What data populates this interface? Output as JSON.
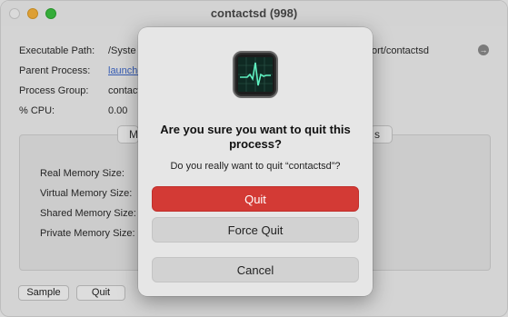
{
  "window": {
    "title": "contactsd (998)"
  },
  "info": {
    "executable_label": "Executable Path:",
    "executable_value": "/Syste",
    "executable_tail": "ort/contactsd",
    "parent_label": "Parent Process:",
    "parent_value": "launchd",
    "group_label": "Process Group:",
    "group_value": "contacts",
    "cpu_label": "% CPU:",
    "cpu_value": "0.00"
  },
  "tabs": {
    "left_fragment": "M",
    "right_fragment": "s"
  },
  "memory": {
    "real": "Real Memory Size:",
    "virtual": "Virtual Memory Size:",
    "shared": "Shared Memory Size:",
    "private": "Private Memory Size:"
  },
  "bottom_buttons": {
    "sample": "Sample",
    "quit": "Quit"
  },
  "dialog": {
    "icon": "activity-monitor-icon",
    "title": "Are you sure you want to quit this process?",
    "message": "Do you really want to quit “contactsd”?",
    "quit_label": "Quit",
    "force_quit_label": "Force Quit",
    "cancel_label": "Cancel",
    "quit_color": "#d33a35"
  }
}
